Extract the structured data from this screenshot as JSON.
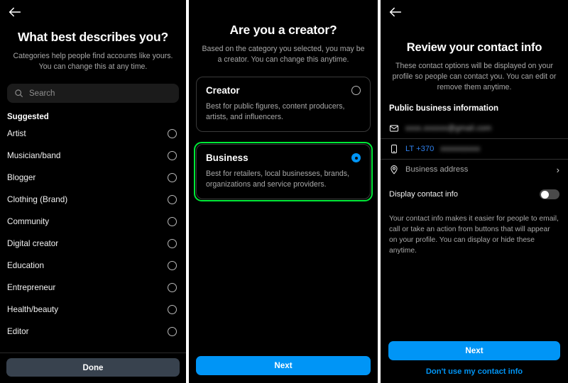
{
  "panel1": {
    "back_icon": "back-arrow-icon",
    "title": "What best describes you?",
    "subtitle": "Categories help people find accounts like yours. You can change this at any time.",
    "search": {
      "icon": "search-icon",
      "placeholder": "Search",
      "value": ""
    },
    "section_label": "Suggested",
    "items": [
      {
        "label": "Artist",
        "selected": false
      },
      {
        "label": "Musician/band",
        "selected": false
      },
      {
        "label": "Blogger",
        "selected": false
      },
      {
        "label": "Clothing (Brand)",
        "selected": false
      },
      {
        "label": "Community",
        "selected": false
      },
      {
        "label": "Digital creator",
        "selected": false
      },
      {
        "label": "Education",
        "selected": false
      },
      {
        "label": "Entrepreneur",
        "selected": false
      },
      {
        "label": "Health/beauty",
        "selected": false
      },
      {
        "label": "Editor",
        "selected": false
      }
    ],
    "done_label": "Done",
    "done_color": "#38424e"
  },
  "panel2": {
    "title": "Are you a creator?",
    "subtitle": "Based on the category you selected, you may be a creator. You can change this anytime.",
    "options": [
      {
        "title": "Creator",
        "description": "Best for public figures, content producers, artists, and influencers.",
        "selected": false,
        "highlighted": false
      },
      {
        "title": "Business",
        "description": "Best for retailers, local businesses, brands, organizations and service providers.",
        "selected": true,
        "highlighted": true
      }
    ],
    "highlight_color": "#00e838",
    "next_label": "Next",
    "accent_color": "#0095f6"
  },
  "panel3": {
    "back_icon": "back-arrow-icon",
    "title": "Review your contact info",
    "subtitle": "These contact options will be displayed on your profile so people can contact you. You can edit or remove them anytime.",
    "section_label": "Public business information",
    "rows": [
      {
        "icon": "envelope-icon",
        "value": "xxxx.xxxxxx@gmail.com",
        "redacted": true,
        "prefix": "",
        "chevron": false
      },
      {
        "icon": "phone-icon",
        "prefix": "LT +370",
        "value": "xxxxxxxxxx",
        "redacted": true,
        "chevron": false
      },
      {
        "icon": "location-pin-icon",
        "value": "Business address",
        "redacted": false,
        "prefix": "",
        "chevron": true
      }
    ],
    "toggle": {
      "label": "Display contact info",
      "on": false
    },
    "note": "Your contact info makes it easier for people to email, call or take an action from buttons that will appear on your profile. You can display or hide these anytime.",
    "next_label": "Next",
    "secondary_label": "Don't use my contact info",
    "accent_color": "#0095f6"
  }
}
